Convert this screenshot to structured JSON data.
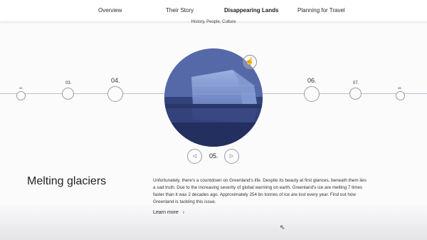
{
  "nav": {
    "items": [
      {
        "label": "Overview"
      },
      {
        "label": "Their Story"
      },
      {
        "label": "Disappearing Lands",
        "active": true
      },
      {
        "label": "Planning for Travel"
      }
    ]
  },
  "subtitle": "History, People, Culture",
  "timeline": {
    "nodes": [
      {
        "label": "02."
      },
      {
        "label": "03."
      },
      {
        "label": "04."
      },
      {
        "label": "06."
      },
      {
        "label": "07."
      },
      {
        "label": "08."
      }
    ],
    "current": "05."
  },
  "controls": {
    "prev_icon": "chevron-left-icon",
    "next_icon": "chevron-right-icon"
  },
  "section": {
    "title": "Melting glaciers",
    "body": "Unfortunately, there's a countdown on Greenland's life. Despite its beauty at first glances, beneath them lies a sad truth. Due to the increasing severity of global warming on earth, Greenland's ice are melting 7 times faster than it was 2 decades ago. Approximately 254 bn tonnes of ice are lost every year. Find out how Greenland is tackling this issue.",
    "link": "Learn more"
  },
  "colors": {
    "globe": "#4f62a0",
    "line": "#bfc0c8"
  }
}
